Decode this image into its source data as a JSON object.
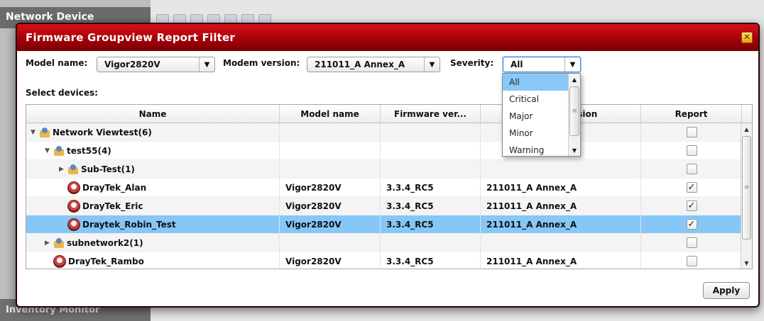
{
  "background": {
    "left_header": "Network Device",
    "left_footer": "Inventory Monitor"
  },
  "dialog": {
    "title": "Firmware Groupview Report Filter",
    "close_icon": "close-icon"
  },
  "filters": {
    "model_label": "Model name:",
    "model_value": "Vigor2820V",
    "modem_label": "Modem version:",
    "modem_value": "211011_A Annex_A",
    "severity_label": "Severity:",
    "severity_value": "All",
    "severity_options": [
      "All",
      "Critical",
      "Major",
      "Minor",
      "Warning"
    ],
    "severity_active_index": 0
  },
  "select_devices_label": "Select devices:",
  "table": {
    "columns": [
      "Name",
      "Model name",
      "Firmware ver...",
      "Modem version",
      "Report"
    ],
    "rows": [
      {
        "indent": 0,
        "expand": "▼",
        "icon": "group-icon",
        "name": "Network Viewtest(6)",
        "model": "",
        "firmware": "",
        "modem": "",
        "checked": false,
        "selected": false
      },
      {
        "indent": 1,
        "expand": "▼",
        "icon": "group-icon",
        "name": "test55(4)",
        "model": "",
        "firmware": "",
        "modem": "",
        "checked": false,
        "selected": false
      },
      {
        "indent": 2,
        "expand": "▶",
        "icon": "group-icon",
        "name": "Sub-Test(1)",
        "model": "",
        "firmware": "",
        "modem": "",
        "checked": false,
        "selected": false
      },
      {
        "indent": 2,
        "expand": "",
        "icon": "router-icon",
        "name": "DrayTek_Alan",
        "model": "Vigor2820V",
        "firmware": "3.3.4_RC5",
        "modem": "211011_A Annex_A",
        "checked": true,
        "selected": false
      },
      {
        "indent": 2,
        "expand": "",
        "icon": "router-icon",
        "name": "DrayTek_Eric",
        "model": "Vigor2820V",
        "firmware": "3.3.4_RC5",
        "modem": "211011_A Annex_A",
        "checked": true,
        "selected": false
      },
      {
        "indent": 2,
        "expand": "",
        "icon": "router-icon",
        "name": "Draytek_Robin_Test",
        "model": "Vigor2820V",
        "firmware": "3.3.4_RC5",
        "modem": "211011_A Annex_A",
        "checked": true,
        "selected": true
      },
      {
        "indent": 1,
        "expand": "▶",
        "icon": "group-icon",
        "name": "subnetwork2(1)",
        "model": "",
        "firmware": "",
        "modem": "",
        "checked": false,
        "selected": false
      },
      {
        "indent": 1,
        "expand": "",
        "icon": "router-icon",
        "name": "DrayTek_Rambo",
        "model": "Vigor2820V",
        "firmware": "3.3.4_RC5",
        "modem": "211011_A Annex_A",
        "checked": false,
        "selected": false
      }
    ]
  },
  "apply_label": "Apply",
  "glyphs": {
    "arrow_down": "▼",
    "arrow_up": "▲",
    "check": "✓",
    "close": "✕",
    "grip": "≡"
  }
}
